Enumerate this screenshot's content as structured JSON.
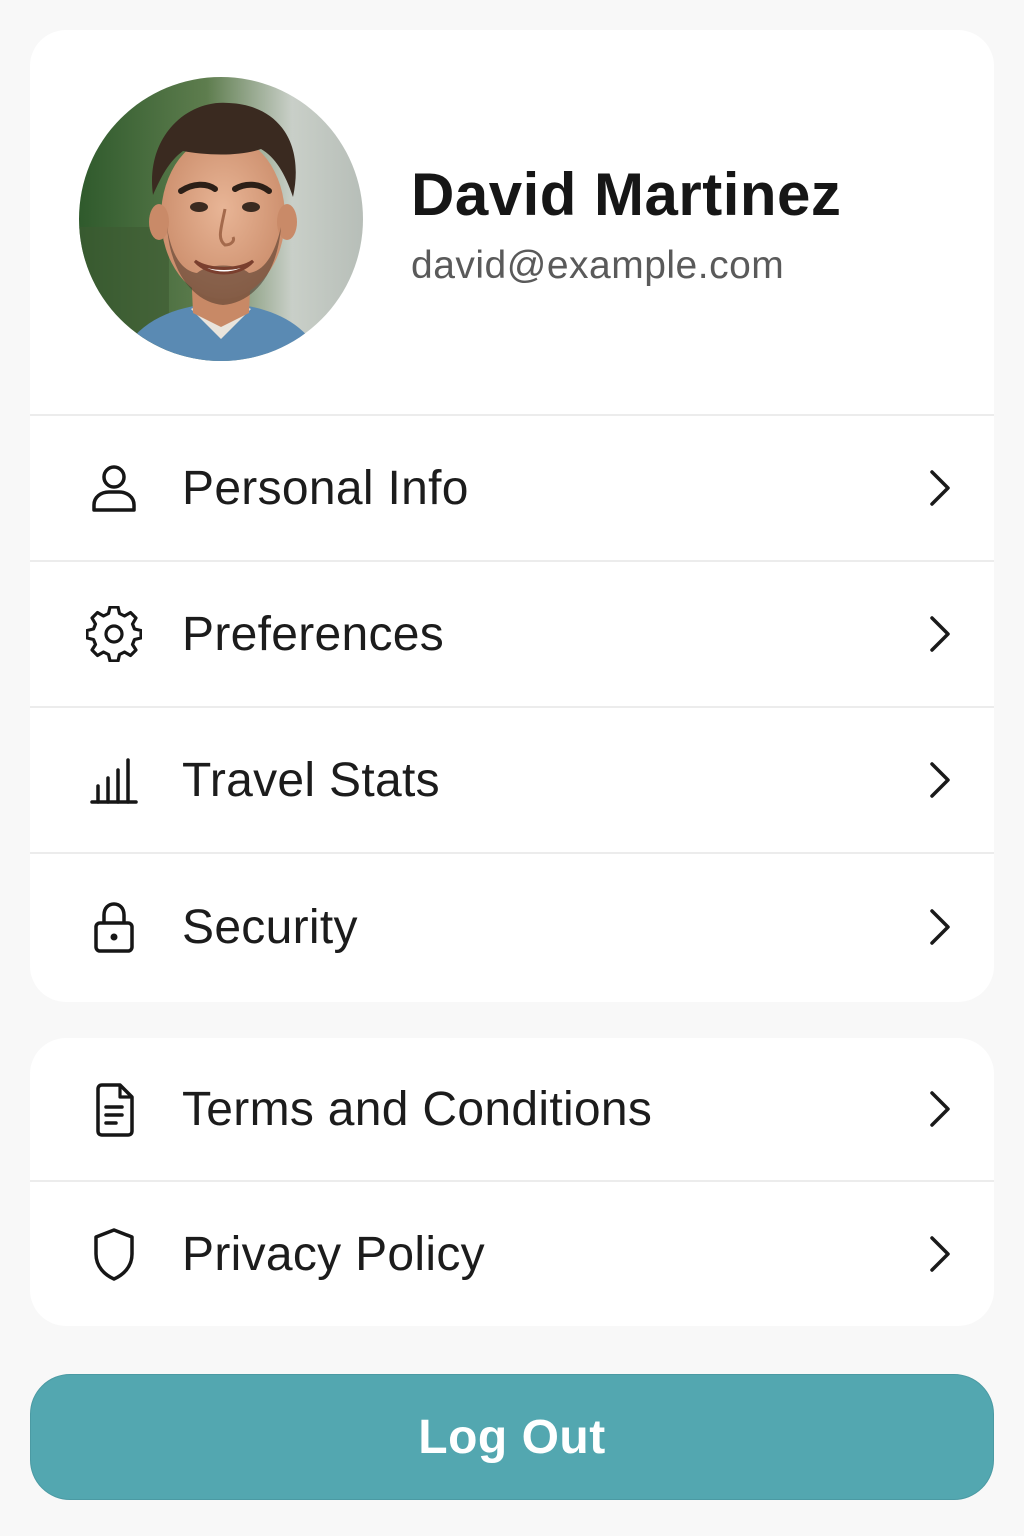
{
  "profile": {
    "name": "David Martinez",
    "email": "david@example.com"
  },
  "menu": {
    "items": [
      {
        "label": "Personal Info",
        "icon": "user-icon"
      },
      {
        "label": "Preferences",
        "icon": "gear-icon"
      },
      {
        "label": "Travel Stats",
        "icon": "bar-chart-icon"
      },
      {
        "label": "Security",
        "icon": "lock-icon"
      }
    ]
  },
  "legal": {
    "items": [
      {
        "label": "Terms and Conditions",
        "icon": "document-icon"
      },
      {
        "label": "Privacy Policy",
        "icon": "shield-icon"
      }
    ]
  },
  "logout": {
    "label": "Log Out"
  },
  "colors": {
    "accent": "#53a7b0",
    "background": "#f8f8f8",
    "card": "#ffffff",
    "text": "#1a1a1a",
    "secondary_text": "#5a5a5a",
    "divider": "#ececec"
  }
}
